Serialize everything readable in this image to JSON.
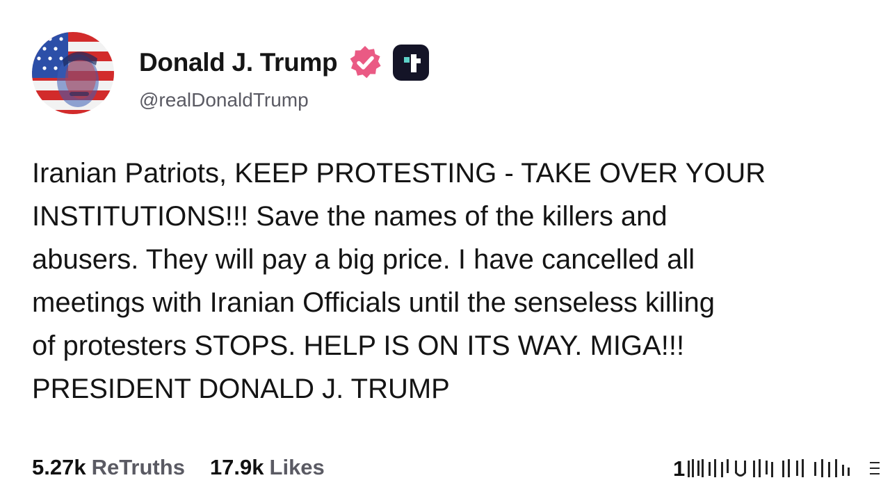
{
  "author": {
    "display_name": "Donald J. Trump",
    "handle": "@realDonaldTrump",
    "avatar_icon": "stars-and-stripes-portrait",
    "verified_icon": "verified-badge-icon",
    "platform_icon": "truth-social-logo-icon"
  },
  "post": {
    "lines": [
      "Iranian Patriots, KEEP PROTESTING - TAKE OVER YOUR",
      "INSTITUTIONS!!! Save the names of the killers and",
      "abusers. They will pay a big price. I have cancelled all",
      "meetings with Iranian Officials until the senseless killing",
      "of protesters STOPS. HELP IS ON ITS WAY. MIGA!!!",
      "PRESIDENT DONALD J. TRUMP"
    ]
  },
  "stats": {
    "retruths_value": "5.27k",
    "retruths_label": "ReTruths",
    "likes_value": "17.9k",
    "likes_label": "Likes",
    "views_visible": "1"
  },
  "colors": {
    "verified_badge": "#ea5a84",
    "platform_logo_bg": "#141427",
    "platform_logo_accent": "#5ed2c8",
    "muted_text": "#5a5a63"
  }
}
